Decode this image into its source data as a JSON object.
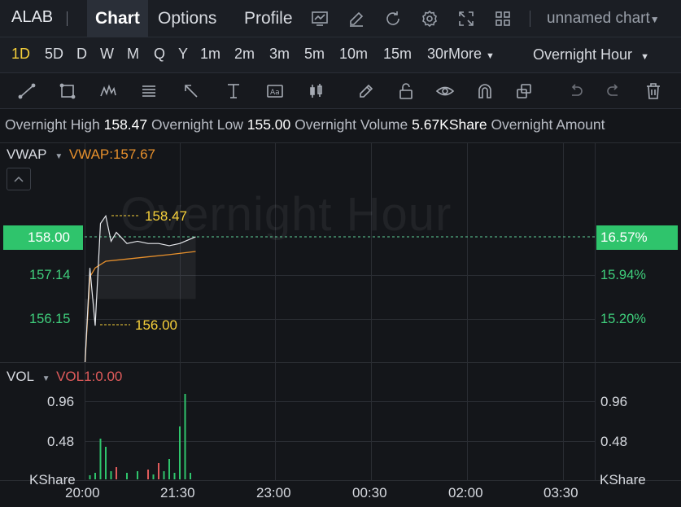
{
  "topbar": {
    "ticker": "ALAB",
    "tabs": [
      "Chart",
      "Options",
      "Profile"
    ],
    "chart_name": "unnamed chart"
  },
  "intervals": {
    "items": [
      "1D",
      "5D",
      "D",
      "W",
      "M",
      "Q",
      "Y",
      "1m",
      "2m",
      "3m",
      "5m",
      "10m",
      "15m",
      "30r"
    ],
    "more": "More",
    "session": "Overnight Hour"
  },
  "info": {
    "high_label": "Overnight High",
    "high_value": "158.47",
    "low_label": "Overnight Low",
    "low_value": "155.00",
    "volume_label": "Overnight Volume",
    "volume_value": "5.67KShare",
    "amount_label": "Overnight Amount"
  },
  "price_panel": {
    "indicator": "VWAP",
    "indicator_value": "VWAP:157.67",
    "watermark": "Overnight Hour",
    "current_price": "158.00",
    "current_pct": "16.57%",
    "left_ticks": [
      "157.14",
      "156.15"
    ],
    "right_ticks": [
      "15.94%",
      "15.20%"
    ],
    "high_marker": "158.47",
    "low_marker": "156.00"
  },
  "volume_panel": {
    "indicator": "VOL",
    "indicator_value": "VOL1:0.00",
    "ticks": [
      "0.96",
      "0.48"
    ],
    "unit": "KShare"
  },
  "time_axis": [
    "20:00",
    "21:30",
    "23:00",
    "00:30",
    "02:00",
    "03:30"
  ],
  "colors": {
    "up": "#2fc46c",
    "down": "#e05b5b",
    "vwap": "#e7902c",
    "marker": "#f6d03a",
    "active": "#f6d03a"
  },
  "chart_data": {
    "type": "line",
    "price_series": {
      "x": [
        "20:00",
        "20:05",
        "20:10",
        "20:15",
        "20:20",
        "20:25",
        "20:30",
        "20:40",
        "20:50",
        "21:00",
        "21:10",
        "21:20",
        "21:30",
        "21:40",
        "21:45"
      ],
      "y": [
        155.0,
        157.3,
        156.0,
        158.3,
        158.47,
        157.9,
        158.1,
        157.85,
        157.9,
        157.85,
        157.85,
        157.8,
        157.85,
        157.95,
        158.0
      ]
    },
    "vwap_series": {
      "name": "VWAP",
      "x": [
        "20:00",
        "20:05",
        "20:10",
        "20:20",
        "20:40",
        "21:00",
        "21:20",
        "21:45"
      ],
      "y": [
        155.0,
        157.1,
        157.3,
        157.45,
        157.5,
        157.55,
        157.6,
        157.67
      ]
    },
    "volume": {
      "x": [
        "20:05",
        "20:10",
        "20:15",
        "20:20",
        "20:25",
        "20:30",
        "20:40",
        "20:50",
        "21:00",
        "21:05",
        "21:10",
        "21:15",
        "21:20",
        "21:25",
        "21:30",
        "21:35",
        "21:40"
      ],
      "values": [
        0.05,
        0.08,
        0.5,
        0.4,
        0.1,
        0.15,
        0.08,
        0.1,
        0.12,
        0.06,
        0.2,
        0.1,
        0.25,
        0.08,
        0.65,
        1.05,
        0.08
      ],
      "up": [
        true,
        true,
        true,
        true,
        true,
        false,
        true,
        true,
        false,
        true,
        false,
        true,
        true,
        true,
        true,
        true,
        true
      ]
    },
    "ylim_price": [
      154.9,
      158.6
    ],
    "ylim_volume": [
      0,
      1.2
    ]
  }
}
